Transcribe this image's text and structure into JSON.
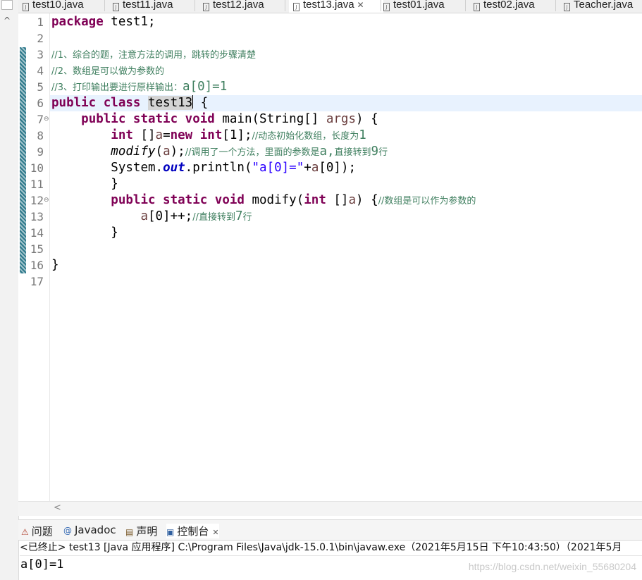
{
  "editor_tabs": [
    {
      "label": "test10.java",
      "active": false
    },
    {
      "label": "test11.java",
      "active": false
    },
    {
      "label": "test12.java",
      "active": false
    },
    {
      "label": "test13.java",
      "active": true
    },
    {
      "label": "test01.java",
      "active": false
    },
    {
      "label": "test02.java",
      "active": false
    },
    {
      "label": "Teacher.java",
      "active": false
    }
  ],
  "tab_close_glyph": "✕",
  "file_icon_letter": "J",
  "line_numbers": [
    "1",
    "2",
    "3",
    "4",
    "5",
    "6",
    "7",
    "8",
    "9",
    "10",
    "11",
    "12",
    "13",
    "14",
    "15",
    "16",
    "17"
  ],
  "code": {
    "l1_kw": "package",
    "l1_rest": " test1;",
    "l3": "//1、综合的题，注意方法的调用，跳转的步骤清楚",
    "l4": "//2、数组是可以做为参数的",
    "l5_zh": "//3、打印输出要进行原样输出：",
    "l5_tail": "a[0]=1",
    "l6_kw": "public class",
    "l6_name": "test13",
    "l6_rest": " {",
    "l7_kw": "public static void",
    "l7_rest": " main(String[] ",
    "l7_var": "args",
    "l7_end": ") {",
    "l8_kw1": "int",
    "l8_mid1": " []",
    "l8_var": "a",
    "l8_mid2": "=",
    "l8_kw2": "new int",
    "l8_mid3": "[1];",
    "l8_cm": "//动态初始化数组，长度为",
    "l8_cm2": "1",
    "l9_call": "modify",
    "l9_mid": "(",
    "l9_var": "a",
    "l9_end": ");",
    "l9_cm": "//调用了一个方法，里面的参数是",
    "l9_cm2": "a,",
    "l9_cm3": "直接转到",
    "l9_cm4": "9",
    "l9_cm5": "行",
    "l10_a": "System.",
    "l10_field": "out",
    "l10_b": ".println(",
    "l10_str": "\"a[0]=\"",
    "l10_c": "+",
    "l10_var": "a",
    "l10_d": "[0]);",
    "l11": "}",
    "l12_kw": "public static void",
    "l12_mid": " modify(",
    "l12_kw2": "int",
    "l12_mid2": " []",
    "l12_var": "a",
    "l12_end": ") {",
    "l12_cm": "//数组是可以作为参数的",
    "l13_var": "a",
    "l13_mid": "[0]++;",
    "l13_cm": "//直接转到",
    "l13_cm2": "7",
    "l13_cm3": "行",
    "l14": "}",
    "l16": "}"
  },
  "fold_marker": "⊖",
  "view_tabs": [
    {
      "label": "问题",
      "icon": "problems-icon",
      "glyph": "⚠"
    },
    {
      "label": "Javadoc",
      "icon": "javadoc-icon",
      "glyph": "@"
    },
    {
      "label": "声明",
      "icon": "declaration-icon",
      "glyph": "▤"
    },
    {
      "label": "控制台",
      "icon": "console-icon",
      "glyph": "▣"
    }
  ],
  "view_close_glyph": "✕",
  "console_header": "<已终止> test13 [Java 应用程序] C:\\Program Files\\Java\\jdk-15.0.1\\bin\\javaw.exe（2021年5月15日 下午10:43:50）（2021年5月",
  "console_output": "a[0]=1",
  "watermark": "https://blog.csdn.net/weixin_55680204",
  "scroll_left_glyph": "<",
  "scroll_up_glyph": "^",
  "colors": {
    "keyword": "#7f0055",
    "comment": "#3f7f5f",
    "string": "#2a00ff",
    "field": "#0000c0",
    "current_line": "#e8f2fe"
  }
}
